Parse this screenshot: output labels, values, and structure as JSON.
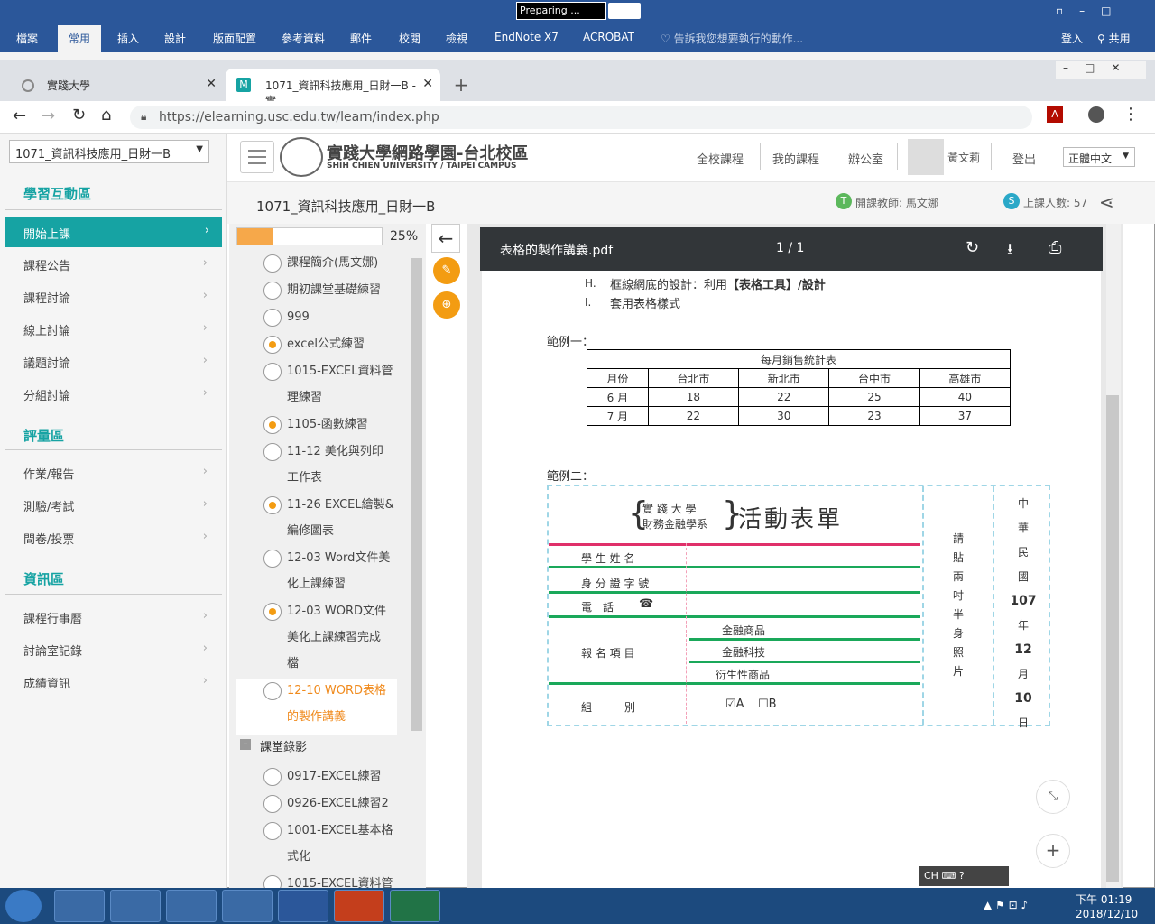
{
  "word": {
    "status": "Preparing ...",
    "tabs": [
      "檔案",
      "常用",
      "插入",
      "設計",
      "版面配置",
      "參考資料",
      "郵件",
      "校閱",
      "檢視",
      "EndNote X7",
      "ACROBAT"
    ],
    "tell_me": "告訴我您想要執行的動作...",
    "signin": "登入",
    "share": "共用"
  },
  "browser": {
    "tab1": "實踐大學",
    "tab2": "1071_資訊科技應用_日財一B - 實",
    "url": "https://elearning.usc.edu.tw/learn/index.php"
  },
  "sidebar": {
    "course": "1071_資訊科技應用_日財一B",
    "sec1": "學習互動區",
    "items1": [
      "開始上課",
      "課程公告",
      "課程討論",
      "線上討論",
      "議題討論",
      "分組討論"
    ],
    "sec2": "評量區",
    "items2": [
      "作業/報告",
      "測驗/考試",
      "問卷/投票"
    ],
    "sec3": "資訊區",
    "items3": [
      "課程行事曆",
      "討論室記錄",
      "成績資訊"
    ]
  },
  "header": {
    "logo_title": "實踐大學網路學園-台北校區",
    "logo_sub": "SHIH CHIEN UNIVERSITY / TAIPEI CAMPUS",
    "nav": [
      "全校課程",
      "我的課程",
      "辦公室"
    ],
    "user": "黃文莉",
    "logout": "登出",
    "lang": "正體中文",
    "course_title": "1071_資訊科技應用_日財一B",
    "teacher": "開課教師: 馬文娜",
    "attend": "上課人數: 57"
  },
  "progress": {
    "percent": "25%",
    "percent_value": 0.25,
    "items": [
      {
        "l1": "課程簡介(馬文娜)",
        "l2": "",
        "on": false
      },
      {
        "l1": "期初課堂基礎練習",
        "l2": "",
        "on": false
      },
      {
        "l1": "999",
        "l2": "",
        "on": false
      },
      {
        "l1": "excel公式練習",
        "l2": "",
        "on": true
      },
      {
        "l1": "1015-EXCEL資料管",
        "l2": "理練習",
        "on": false
      },
      {
        "l1": "1105-函數練習",
        "l2": "",
        "on": true
      },
      {
        "l1": "11-12 美化與列印",
        "l2": "工作表",
        "on": false
      },
      {
        "l1": "11-26 EXCEL繪製&",
        "l2": "編修圖表",
        "on": true
      },
      {
        "l1": "12-03 Word文件美",
        "l2": "化上課練習",
        "on": false
      },
      {
        "l1": "12-03 WORD文件",
        "l2": "美化上課練習完成",
        "l3": "檔",
        "on": true
      },
      {
        "l1": "12-10 WORD表格",
        "l2": "的製作講義",
        "on": false,
        "current": true
      }
    ],
    "group": "課堂錄影",
    "items2": [
      {
        "l1": "0917-EXCEL練習",
        "l2": ""
      },
      {
        "l1": "0926-EXCEL練習2",
        "l2": ""
      },
      {
        "l1": "1001-EXCEL基本格",
        "l2": "式化"
      },
      {
        "l1": "1015-EXCEL資料管",
        "l2": ""
      }
    ]
  },
  "pdf": {
    "name": "表格的製作講義.pdf",
    "pages": "1 / 1",
    "lineH_mark": "H.",
    "lineH": "框線網底的設計：利用",
    "lineH_bold": "【表格工具】/設計",
    "lineI_mark": "I.",
    "lineI": "套用表格樣式",
    "ex1": "範例一：",
    "table_title": "每月銷售統計表",
    "headers": [
      "月份",
      "台北市",
      "新北市",
      "台中市",
      "高雄市"
    ],
    "rows": [
      [
        "6 月",
        "18",
        "22",
        "25",
        "40"
      ],
      [
        "7 月",
        "22",
        "30",
        "23",
        "37"
      ]
    ],
    "ex2": "範例二：",
    "form_school1": "實 踐 大 學",
    "form_school2": "財務金融學系",
    "form_title": "活動表單",
    "f_name": "學 生 姓 名",
    "f_id": "身 分 證 字 號",
    "f_tel": "電　話",
    "f_items": "報 名 項 目",
    "f_opt": [
      "金融商品",
      "金融科技",
      "衍生性商品"
    ],
    "f_group": "組　　　別",
    "f_a": "☑A",
    "f_b": "☐B",
    "photo": [
      "請",
      "貼",
      "兩",
      "吋",
      "半",
      "身",
      "照",
      "片"
    ],
    "date": [
      "中",
      "華",
      "民",
      "國",
      "107",
      "年",
      "12",
      "月",
      "10",
      "日"
    ]
  },
  "ime": "CH",
  "clock": {
    "time": "下午 01:19",
    "date": "2018/12/10"
  }
}
